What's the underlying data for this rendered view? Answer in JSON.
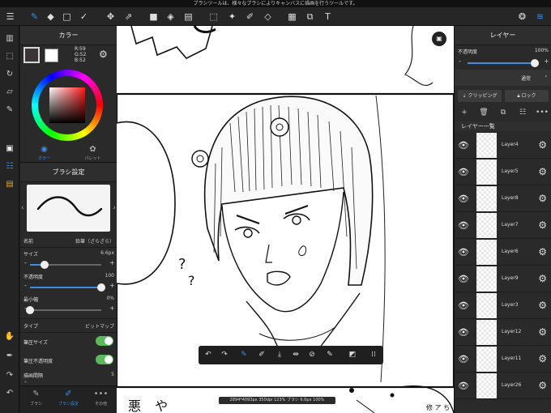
{
  "status_message": "ブラシツールは、様々なブラシによりキャンバスに描画を行うツールです。",
  "toolbar": {
    "icons": [
      "brush-tool-icon",
      "eraser-tool-icon",
      "select-square-icon",
      "correction-icon",
      "move-icon",
      "transform-icon",
      "fill-color-icon",
      "bucket-icon",
      "gradient-icon",
      "selection-icon",
      "magic-wand-icon",
      "select-pen-icon",
      "select-eraser-icon",
      "frame-icon",
      "hand-select-icon",
      "text-tool-icon",
      "material-icon",
      "layers-icon"
    ]
  },
  "color_panel": {
    "title": "カラー",
    "r": "R:59",
    "g": "G:52",
    "b": "B:52",
    "tab_color": "カラー",
    "tab_palette": "パレット",
    "foreground_hex": "#3b3434"
  },
  "brush_panel": {
    "title": "ブラシ設定",
    "name_label": "名前",
    "name_value": "鉛筆（ざらざら）",
    "size_label": "サイズ",
    "size_value": "6.6px",
    "size_fraction": 0.2,
    "opacity_label": "不透明度",
    "opacity_value": "100",
    "opacity_fraction": 1.0,
    "min_width_label": "最小幅",
    "min_width_value": "0%",
    "min_width_fraction": 0.0,
    "type_label": "タイプ",
    "type_value": "ビットマップ",
    "pressure_size_label": "筆圧サイズ",
    "pressure_opacity_label": "筆圧不透明度",
    "interval_label": "描画間隔",
    "interval_value": "5"
  },
  "left_tabs": [
    "ブラシ",
    "ブラシ設定",
    "その他"
  ],
  "layer_panel": {
    "title": "レイヤー",
    "opacity_label": "不透明度",
    "opacity_value": "100%",
    "blend_mode": "通常",
    "clipping_label": "クリッピング",
    "lock_label": "ロック",
    "list_header": "レイヤー一覧",
    "layers": [
      {
        "name": "Layer4"
      },
      {
        "name": "Layer5"
      },
      {
        "name": "Layer8"
      },
      {
        "name": "Layer7"
      },
      {
        "name": "Layer6"
      },
      {
        "name": "Layer9"
      },
      {
        "name": "Layer3"
      },
      {
        "name": "Layer12"
      },
      {
        "name": "Layer11"
      },
      {
        "name": "Layer26"
      }
    ]
  },
  "canvas_status": "2894*4093px 350dpi 123% ブラシ 6.6px 100%",
  "canvas_text": {
    "bottom_left_text": "悪 や",
    "bottom_right_text": "修 ア ち"
  }
}
